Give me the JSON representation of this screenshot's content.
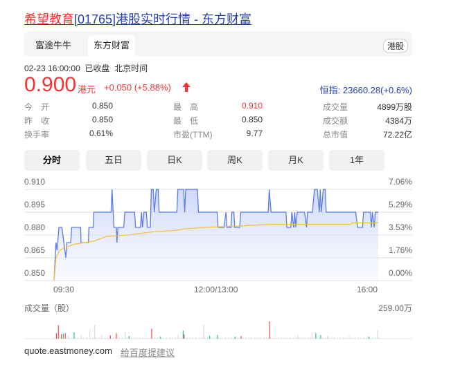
{
  "header": {
    "title_highlight": "希望教育",
    "title_rest": "[01765]港股实时行情 - 东方财富"
  },
  "tabs": [
    {
      "label": "富途牛牛"
    },
    {
      "label": "东方财富"
    }
  ],
  "market_badge": "港股",
  "status": {
    "datetime": "02-23 16:00:00",
    "state": "已收盘",
    "tz": "北京时间"
  },
  "quote": {
    "price": "0.900",
    "unit": "港元",
    "change": "+0.050 (+5.88%)",
    "hsi": "恒指: 23660.28(+0.6%)"
  },
  "stats": [
    [
      {
        "label": "今　开",
        "value": "0.850"
      },
      {
        "label": "最　高",
        "value": "0.910",
        "red": true
      },
      {
        "label": "成交量",
        "value": "4899万股"
      }
    ],
    [
      {
        "label": "昨　收",
        "value": "0.850"
      },
      {
        "label": "最　低",
        "value": "0.850"
      },
      {
        "label": "成交额",
        "value": "4384万"
      }
    ],
    [
      {
        "label": "换手率",
        "value": "0.61%"
      },
      {
        "label": "市盈(TTM)",
        "value": "9.77"
      },
      {
        "label": "总市值",
        "value": "72.22亿"
      }
    ]
  ],
  "periods": [
    {
      "label": "分时"
    },
    {
      "label": "五日"
    },
    {
      "label": "日K"
    },
    {
      "label": "周K"
    },
    {
      "label": "月K"
    },
    {
      "label": "1年"
    }
  ],
  "chart_data": {
    "type": "line",
    "y_ticks": [
      "0.910",
      "0.895",
      "0.880",
      "0.865",
      "0.850"
    ],
    "y_pct_ticks": [
      "7.06%",
      "5.29%",
      "3.53%",
      "1.76%",
      "0.00%"
    ],
    "ylim": [
      0.85,
      0.91
    ],
    "x_ticks": [
      "09:30",
      "12:00/13:00",
      "16:00"
    ],
    "x_range_minutes": [
      0,
      330
    ],
    "price": [
      [
        0,
        0.85
      ],
      [
        2,
        0.875
      ],
      [
        3,
        0.87
      ],
      [
        5,
        0.885
      ],
      [
        8,
        0.885
      ],
      [
        10,
        0.875
      ],
      [
        12,
        0.865
      ],
      [
        13,
        0.875
      ],
      [
        17,
        0.875
      ],
      [
        18,
        0.885
      ],
      [
        27,
        0.885
      ],
      [
        27.5,
        0.875
      ],
      [
        35,
        0.875
      ],
      [
        35.5,
        0.885
      ],
      [
        40,
        0.885
      ],
      [
        40.5,
        0.895
      ],
      [
        58,
        0.895
      ],
      [
        59,
        0.91
      ],
      [
        61,
        0.885
      ],
      [
        63.5,
        0.885
      ],
      [
        64,
        0.875
      ],
      [
        65,
        0.885
      ],
      [
        71,
        0.885
      ],
      [
        72,
        0.895
      ],
      [
        82,
        0.895
      ],
      [
        83,
        0.885
      ],
      [
        88,
        0.885
      ],
      [
        89,
        0.895
      ],
      [
        90,
        0.885
      ],
      [
        91.5,
        0.895
      ],
      [
        94,
        0.895
      ],
      [
        95,
        0.885
      ],
      [
        98,
        0.885
      ],
      [
        99,
        0.91
      ],
      [
        101,
        0.91
      ],
      [
        102,
        0.895
      ],
      [
        104,
        0.91
      ],
      [
        106,
        0.91
      ],
      [
        107,
        0.895
      ],
      [
        125,
        0.895
      ],
      [
        126,
        0.91
      ],
      [
        132,
        0.91
      ],
      [
        133,
        0.895
      ],
      [
        134,
        0.91
      ],
      [
        146,
        0.91
      ],
      [
        147,
        0.895
      ],
      [
        166,
        0.895
      ],
      [
        167,
        0.885
      ],
      [
        173,
        0.885
      ],
      [
        175,
        0.895
      ],
      [
        176,
        0.885
      ],
      [
        180,
        0.885
      ],
      [
        181,
        0.895
      ],
      [
        183,
        0.895
      ],
      [
        184,
        0.885
      ],
      [
        189,
        0.885
      ],
      [
        190,
        0.895
      ],
      [
        218,
        0.895
      ],
      [
        219,
        0.91
      ],
      [
        221,
        0.895
      ],
      [
        236,
        0.895
      ],
      [
        237,
        0.885
      ],
      [
        241,
        0.885
      ],
      [
        242,
        0.895
      ],
      [
        244,
        0.885
      ],
      [
        245,
        0.895
      ],
      [
        246,
        0.885
      ],
      [
        247.5,
        0.895
      ],
      [
        255,
        0.895
      ],
      [
        257,
        0.885
      ],
      [
        258,
        0.895
      ],
      [
        263,
        0.895
      ],
      [
        265,
        0.91
      ],
      [
        268,
        0.91
      ],
      [
        270,
        0.895
      ],
      [
        271,
        0.91
      ],
      [
        272,
        0.895
      ],
      [
        274,
        0.91
      ],
      [
        276,
        0.91
      ],
      [
        277,
        0.895
      ],
      [
        307,
        0.895
      ],
      [
        309,
        0.885
      ],
      [
        314,
        0.885
      ],
      [
        315,
        0.895
      ],
      [
        322,
        0.895
      ],
      [
        323,
        0.885
      ],
      [
        324,
        0.895
      ],
      [
        326,
        0.885
      ],
      [
        327,
        0.895
      ],
      [
        330,
        0.895
      ]
    ],
    "average": [
      [
        0,
        0.85
      ],
      [
        2,
        0.865
      ],
      [
        6,
        0.87
      ],
      [
        12,
        0.872
      ],
      [
        21,
        0.874
      ],
      [
        41,
        0.876
      ],
      [
        53,
        0.879
      ],
      [
        76,
        0.88
      ],
      [
        99,
        0.882
      ],
      [
        123,
        0.883
      ],
      [
        133,
        0.884
      ],
      [
        152,
        0.885
      ],
      [
        191,
        0.886
      ],
      [
        221,
        0.887
      ],
      [
        302,
        0.887
      ],
      [
        303,
        0.888
      ],
      [
        330,
        0.888
      ]
    ],
    "volume_label": "成交量（股）",
    "volume_max": "259.00万",
    "volume_max_value": 259,
    "volume": [
      [
        2,
        60,
        "up"
      ],
      [
        4,
        150,
        "up"
      ],
      [
        5,
        40,
        "flat"
      ],
      [
        7,
        50,
        "up"
      ],
      [
        9,
        55,
        "down"
      ],
      [
        11,
        60,
        "up"
      ],
      [
        14,
        30,
        "flat"
      ],
      [
        20,
        70,
        "down"
      ],
      [
        27,
        40,
        "flat"
      ],
      [
        36,
        100,
        "flat"
      ],
      [
        41,
        150,
        "flat"
      ],
      [
        48,
        40,
        "flat"
      ],
      [
        57,
        35,
        "up"
      ],
      [
        63,
        60,
        "up"
      ],
      [
        72,
        80,
        "flat"
      ],
      [
        76,
        30,
        "down"
      ],
      [
        99,
        110,
        "up"
      ],
      [
        108,
        20,
        "down"
      ],
      [
        126,
        40,
        "flat"
      ],
      [
        131,
        90,
        "down"
      ],
      [
        132,
        50,
        "up"
      ],
      [
        152,
        150,
        "flat"
      ],
      [
        158,
        30,
        "down"
      ],
      [
        166,
        40,
        "down"
      ],
      [
        184,
        20,
        "down"
      ],
      [
        190,
        30,
        "up"
      ],
      [
        219,
        190,
        "up"
      ],
      [
        248,
        40,
        "flat"
      ],
      [
        262,
        70,
        "flat"
      ],
      [
        266,
        60,
        "down"
      ],
      [
        271,
        40,
        "down"
      ],
      [
        278,
        30,
        "flat"
      ],
      [
        300,
        30,
        "flat"
      ],
      [
        320,
        20,
        "down"
      ],
      [
        329,
        90,
        "flat"
      ]
    ]
  },
  "footer": {
    "source": "quote.eastmoney.com",
    "feedback": "给百度提建议"
  }
}
